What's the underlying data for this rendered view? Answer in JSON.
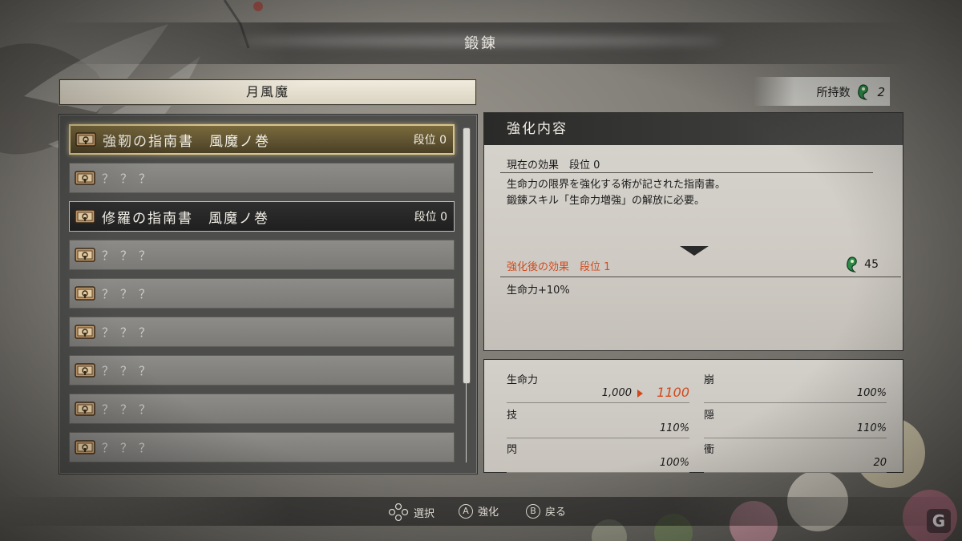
{
  "header": {
    "title": "鍛錬"
  },
  "category": {
    "title": "月風魔"
  },
  "holdings": {
    "label": "所持数",
    "icon": "spirit-magatama-icon",
    "count": "2"
  },
  "list": {
    "items": [
      {
        "name": "強靭の指南書　風魔ノ巻",
        "rank": "段位 0",
        "known": true,
        "state": "selected"
      },
      {
        "name": "？？？",
        "rank": "",
        "known": false,
        "state": "normal"
      },
      {
        "name": "修羅の指南書　風魔ノ巻",
        "rank": "段位 0",
        "known": true,
        "state": "dark"
      },
      {
        "name": "？？？",
        "rank": "",
        "known": false,
        "state": "normal"
      },
      {
        "name": "？？？",
        "rank": "",
        "known": false,
        "state": "normal"
      },
      {
        "name": "？？？",
        "rank": "",
        "known": false,
        "state": "normal"
      },
      {
        "name": "？？？",
        "rank": "",
        "known": false,
        "state": "normal"
      },
      {
        "name": "？？？",
        "rank": "",
        "known": false,
        "state": "normal"
      },
      {
        "name": "？？？",
        "rank": "",
        "known": false,
        "state": "normal"
      }
    ],
    "item_icon": "scroll-book-icon"
  },
  "detail": {
    "title": "強化内容",
    "current_label": "現在の効果　段位 0",
    "description": [
      "生命力の限界を強化する術が記された指南書。",
      "鍛錬スキル「生命力増強」の解放に必要。"
    ],
    "after_label": "強化後の効果　段位 1",
    "cost": "45",
    "effect": "生命力+10%"
  },
  "stats": [
    {
      "name": "生命力",
      "value": "1,000",
      "new_value": "1100"
    },
    {
      "name": "崩",
      "value": "100%"
    },
    {
      "name": "技",
      "value": "110%"
    },
    {
      "name": "隠",
      "value": "110%"
    },
    {
      "name": "閃",
      "value": "100%"
    },
    {
      "name": "衝",
      "value": "20"
    }
  ],
  "controls": {
    "select_label": "選択",
    "confirm_key": "A",
    "confirm_label": "強化",
    "back_key": "B",
    "back_label": "戻る"
  },
  "watermark": "G",
  "colors": {
    "accent_red": "#d04a1d",
    "gold_border": "#d8c58a",
    "spirit_green": "#2f8a4a"
  }
}
